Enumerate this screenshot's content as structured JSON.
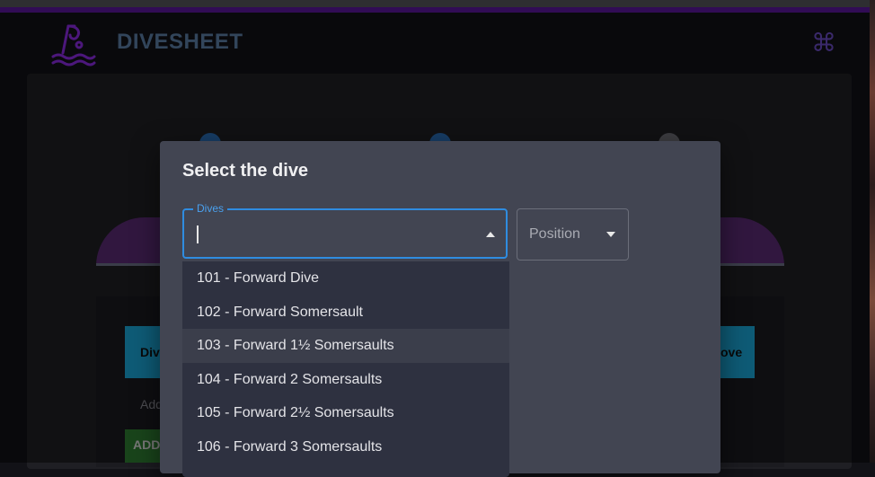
{
  "header": {
    "brand": "DIVESHEET",
    "logo_icon": "diver-logo-icon",
    "command_icon": "command-icon",
    "command_glyph": "⌘"
  },
  "background": {
    "behind_left_button": "Div",
    "behind_right_button": "ove",
    "add_text": "Add",
    "add_button": "ADD"
  },
  "modal": {
    "title": "Select the dive",
    "dives_field": {
      "label": "Dives",
      "value": ""
    },
    "position_field": {
      "placeholder": "Position"
    },
    "options": [
      {
        "label": "101 - Forward Dive"
      },
      {
        "label": "102 - Forward Somersault"
      },
      {
        "label": "103 - Forward 1½ Somersaults",
        "highlighted": true
      },
      {
        "label": "104 - Forward 2 Somersaults"
      },
      {
        "label": "105 - Forward 2½ Somersaults"
      },
      {
        "label": "106 - Forward 3 Somersaults"
      }
    ]
  },
  "colors": {
    "accent": "#2f8ce0",
    "brand_text": "#5b7fa7",
    "purple": "#5a169c",
    "modal_bg": "#424552"
  }
}
